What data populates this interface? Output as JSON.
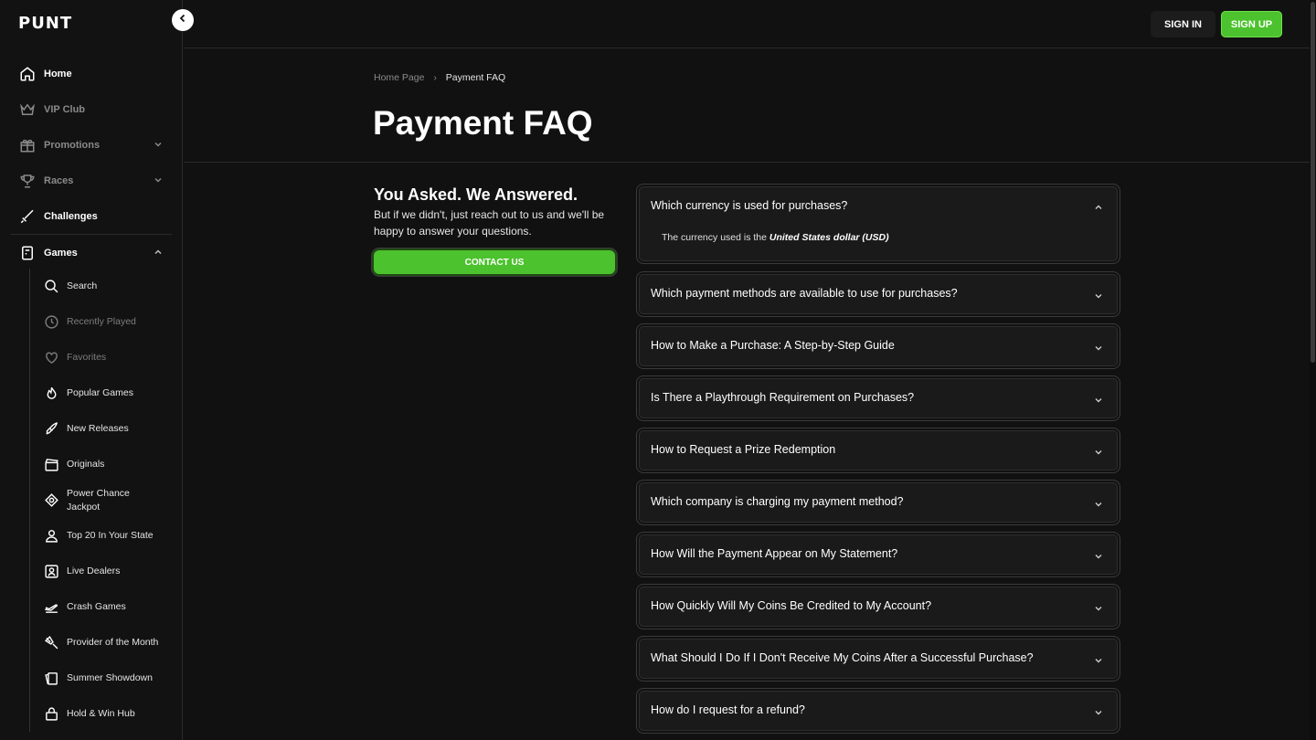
{
  "brand": {
    "logo": "PUNT",
    "accent": "#4cc22e"
  },
  "header": {
    "sign_in": "SIGN IN",
    "sign_up": "SIGN UP"
  },
  "sidebar": {
    "items": [
      {
        "label": "Home",
        "icon": "home-icon"
      },
      {
        "label": "VIP Club",
        "icon": "crown-icon"
      },
      {
        "label": "Promotions",
        "icon": "gift-icon"
      },
      {
        "label": "Races",
        "icon": "trophy-icon"
      },
      {
        "label": "Challenges",
        "icon": "sword-icon"
      },
      {
        "label": "Games",
        "icon": "slot-machine-icon"
      }
    ],
    "games_sub": [
      {
        "label": "Search",
        "icon": "search-icon"
      },
      {
        "label": "Recently Played",
        "icon": "clock-icon"
      },
      {
        "label": "Favorites",
        "icon": "heart-icon"
      },
      {
        "label": "Popular Games",
        "icon": "fire-icon"
      },
      {
        "label": "New Releases",
        "icon": "rocket-icon"
      },
      {
        "label": "Originals",
        "icon": "clapperboard-icon"
      },
      {
        "label": "Power Chance Jackpot",
        "icon": "chip-icon"
      },
      {
        "label": "Top 20 In Your State",
        "icon": "user-badge-icon"
      },
      {
        "label": "Live Dealers",
        "icon": "dealer-icon"
      },
      {
        "label": "Crash Games",
        "icon": "plane-icon"
      },
      {
        "label": "Provider of the Month",
        "icon": "star-badge-icon"
      },
      {
        "label": "Summer Showdown",
        "icon": "cards-icon"
      },
      {
        "label": "Hold & Win Hub",
        "icon": "lock-icon"
      }
    ]
  },
  "breadcrumb": {
    "home": "Home Page",
    "current": "Payment FAQ"
  },
  "page_title": "Payment FAQ",
  "contact": {
    "heading": "You Asked. We Answered.",
    "text": "But if we didn't, just reach out to us and we'll be happy to answer your questions.",
    "button": "CONTACT US"
  },
  "faq": {
    "open_answer_prefix": "The currency used is the ",
    "open_answer_bold": "United States dollar (USD)",
    "questions": [
      "Which currency is used for purchases?",
      "Which payment methods are available to use for purchases?",
      "How to Make a Purchase: A Step-by-Step Guide",
      "Is There a Playthrough Requirement on Purchases?",
      "How to Request a Prize Redemption",
      "Which company is charging my payment method?",
      "How Will the Payment Appear on My Statement?",
      "How Quickly Will My Coins Be Credited to My Account?",
      "What Should I Do If I Don't Receive My Coins After a Successful Purchase?",
      "How do I request for a refund?"
    ]
  }
}
